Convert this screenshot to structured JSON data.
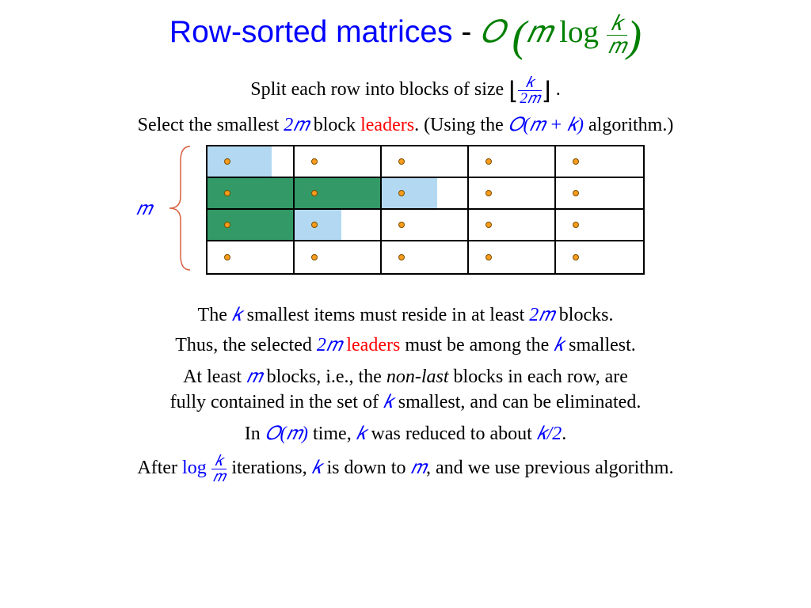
{
  "title": {
    "prefix": "Row-sorted matrices",
    "dash": " - ",
    "O": "𝑂",
    "m": "𝑚",
    "log": " log ",
    "k": "𝑘"
  },
  "line1": {
    "a": "Split each row into blocks of size ",
    "k": "𝑘",
    "tm": "2𝑚",
    "b": " ."
  },
  "line2": {
    "a": "Select the smallest ",
    "tm": "2𝑚",
    "b": " block ",
    "leaders": "leaders",
    "c": ". (Using the ",
    "O": "𝑂(𝑚 + 𝑘)",
    "d": " algorithm.)"
  },
  "diagram": {
    "m_label": "𝑚"
  },
  "line3": {
    "a": "The ",
    "k": "𝑘",
    "b": " smallest items must reside in at least ",
    "tm": "2𝑚",
    "c": " blocks."
  },
  "line4": {
    "a": "Thus, the selected ",
    "tm": "2𝑚",
    "b": " ",
    "leaders": "leaders",
    "c": " must be among the ",
    "k": "𝑘",
    "d": " smallest."
  },
  "line5": {
    "a": "At least ",
    "m": "𝑚",
    "b": " blocks, i.e., the ",
    "nonlast": "non-last",
    "c": " blocks in each row, are",
    "d": "fully contained in the set of ",
    "k": "𝑘",
    "e": " smallest, and can be eliminated."
  },
  "line6": {
    "a": "In ",
    "Om": "𝑂(𝑚)",
    "b": " time, ",
    "k": "𝑘",
    "c": " was reduced to about ",
    "k2": "𝑘/2",
    "d": "."
  },
  "line7": {
    "a": "After ",
    "log": "log ",
    "k": "𝑘",
    "m": "𝑚",
    "b": " iterations, ",
    "kk": "𝑘",
    "c": " is down to ",
    "mm": "𝑚",
    "d": ", and we use previous algorithm."
  }
}
